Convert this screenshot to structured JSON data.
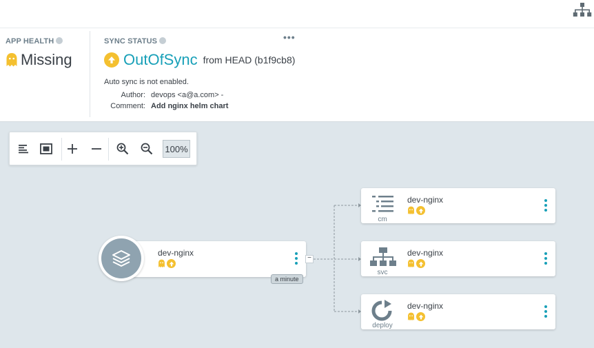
{
  "app_health": {
    "title": "APP HEALTH",
    "status": "Missing",
    "icon": "ghost-icon",
    "color": "#f4c030"
  },
  "sync_status": {
    "title": "SYNC STATUS",
    "status": "OutOfSync",
    "from": "from HEAD (b1f9cb8)",
    "auto_sync": "Auto sync is not enabled.",
    "author_label": "Author:",
    "author": "devops <a@a.com> -",
    "comment_label": "Comment:",
    "comment": "Add nginx helm chart",
    "color": "#18a0b8",
    "menu": "•••"
  },
  "toolbar": {
    "zoom": "100%",
    "buttons": [
      "align-left-icon",
      "fit-screen-icon",
      "plus-icon",
      "minus-icon",
      "zoom-in-icon",
      "zoom-out-icon"
    ]
  },
  "graph": {
    "app": {
      "name": "dev-nginx",
      "age": "a minute",
      "collapse": "−"
    },
    "children": [
      {
        "name": "dev-nginx",
        "kind": "cm",
        "icon": "list-icon"
      },
      {
        "name": "dev-nginx",
        "kind": "svc",
        "icon": "network-icon"
      },
      {
        "name": "dev-nginx",
        "kind": "deploy",
        "icon": "sync-circle-icon"
      }
    ]
  }
}
